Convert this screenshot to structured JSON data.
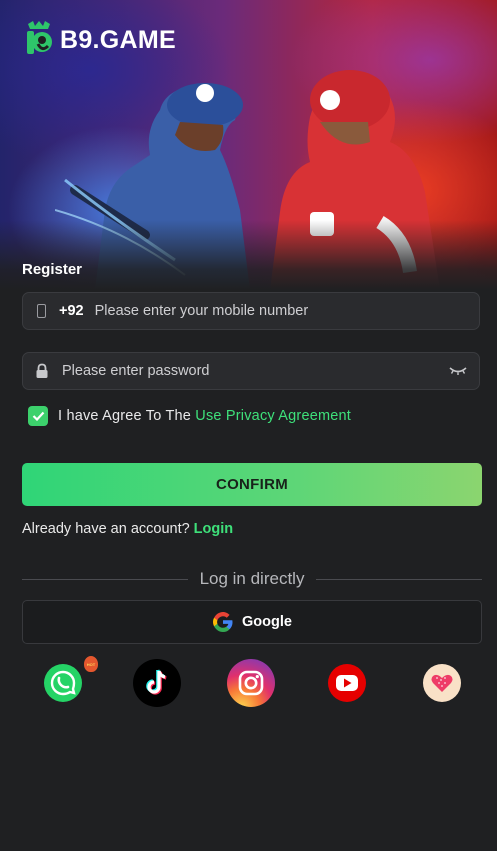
{
  "brand": {
    "name": "B9.GAME"
  },
  "form": {
    "title": "Register",
    "phone": {
      "prefix": "+92",
      "placeholder": "Please enter your mobile number"
    },
    "password": {
      "placeholder": "Please enter password"
    },
    "agreement": {
      "text": "I have Agree To The ",
      "link": "Use Privacy Agreement",
      "checked": true
    },
    "confirm_label": "CONFIRM",
    "login_prompt": "Already have an account?",
    "login_link": "Login"
  },
  "direct_login": {
    "divider_text": "Log in directly",
    "google_label": "Google",
    "socials": [
      "whatsapp-icon",
      "tiktok-icon",
      "instagram-icon",
      "youtube-icon",
      "heart-app-icon"
    ],
    "whatsapp_badge": "HOT"
  },
  "colors": {
    "accent": "#3ee07a",
    "background": "#1f2022",
    "confirm_gradient": [
      "#2fd577",
      "#8bd56f"
    ]
  }
}
